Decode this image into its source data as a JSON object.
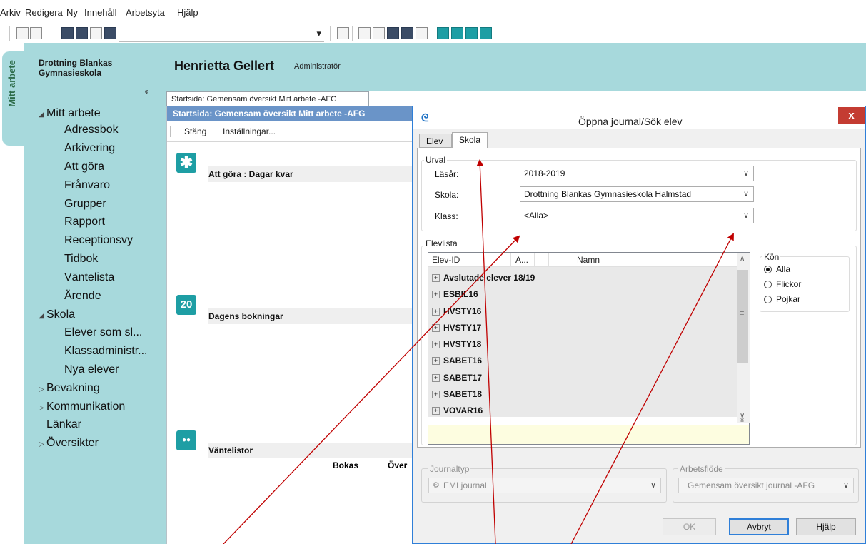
{
  "menu": [
    "Arkiv",
    "Redigera",
    "Ny",
    "Innehåll",
    "Arbetsyta",
    "Hjälp"
  ],
  "left_tab": "Mitt arbete",
  "nav": {
    "school": "Drottning Blankas Gymnasieskola",
    "items": [
      {
        "label": "Mitt arbete",
        "expander": "◢"
      },
      {
        "label": "Adressbok"
      },
      {
        "label": "Arkivering"
      },
      {
        "label": "Att göra"
      },
      {
        "label": "Frånvaro"
      },
      {
        "label": "Grupper"
      },
      {
        "label": "Rapport"
      },
      {
        "label": "Receptionsvy"
      },
      {
        "label": "Tidbok"
      },
      {
        "label": "Väntelista"
      },
      {
        "label": "Ärende"
      },
      {
        "label": "Skola",
        "expander": "◢"
      },
      {
        "label": "Elever som sl..."
      },
      {
        "label": "Klassadministr..."
      },
      {
        "label": "Nya elever"
      },
      {
        "label": "Bevakning",
        "expander": "▷"
      },
      {
        "label": "Kommunikation",
        "expander": "▷"
      },
      {
        "label": "Länkar"
      },
      {
        "label": "Översikter",
        "expander": "▷"
      }
    ]
  },
  "header": {
    "user": "Henrietta Gellert",
    "role": "Administratör"
  },
  "document": {
    "tab": "Startsida: Gemensam översikt Mitt arbete -AFG",
    "title": "Startsida: Gemensam översikt Mitt arbete -AFG",
    "tools": {
      "close": "Stäng",
      "settings": "Inställningar..."
    },
    "sections": [
      {
        "title": "Att göra : Dagar kvar",
        "icon": "asterisk-icon",
        "glyph": "✱"
      },
      {
        "title": "Dagens bokningar",
        "icon": "calendar-icon",
        "glyph": "20"
      },
      {
        "title": "Väntelistor",
        "icon": "people-icon",
        "glyph": "●●"
      }
    ],
    "columns": [
      "Bokas",
      "Över"
    ]
  },
  "dialog": {
    "title": "Öppna journal/Sök elev",
    "close": "x",
    "tabs": [
      "Elev",
      "Skola"
    ],
    "active_tab": "Skola",
    "urval": {
      "label": "Urval",
      "lasar_label": "Läsår:",
      "lasar_value": "2018-2019",
      "skola_label": "Skola:",
      "skola_value": "Drottning Blankas Gymnasieskola Halmstad",
      "klass_label": "Klass:",
      "klass_value": "<Alla>"
    },
    "elevlista": {
      "label": "Elevlista",
      "columns": [
        "Elev-ID",
        "A...",
        "Namn"
      ],
      "rows": [
        "Avslutade elever 18/19",
        "ESBIL16",
        "HVSTY16",
        "HVSTY17",
        "HVSTY18",
        "SABET16",
        "SABET17",
        "SABET18",
        "VOVAR16"
      ]
    },
    "kon": {
      "label": "Kön",
      "options": [
        "Alla",
        "Flickor",
        "Pojkar"
      ],
      "selected": "Alla"
    },
    "journaltyp": {
      "label": "Journaltyp",
      "value": "EMI journal"
    },
    "arbetsflode": {
      "label": "Arbetsflöde",
      "value": "Gemensam översikt journal -AFG"
    },
    "buttons": {
      "ok": "OK",
      "cancel": "Avbryt",
      "help": "Hjälp"
    }
  },
  "colors": {
    "panel": "#a7d9dc",
    "titlebar": "#6a94c8",
    "accent": "#1e9ea4",
    "arrow": "#c00000",
    "close": "#c43c32"
  }
}
